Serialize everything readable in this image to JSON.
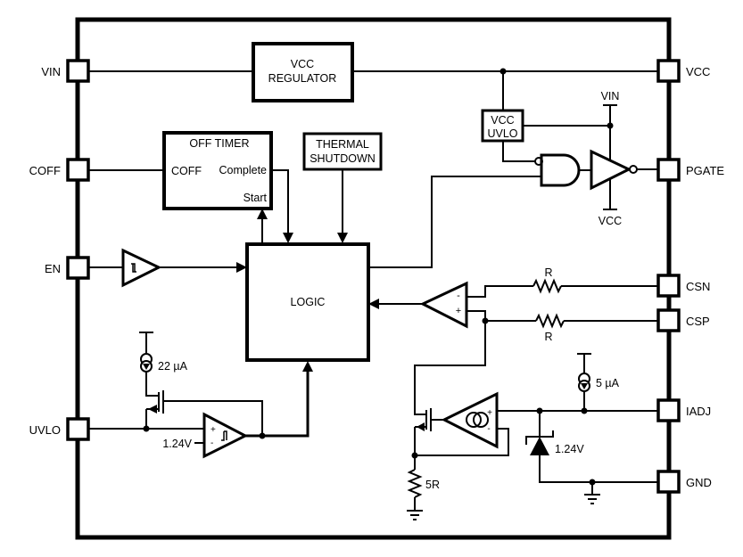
{
  "diagram": {
    "type": "block-diagram",
    "pins_left": [
      {
        "id": "vin",
        "label": "VIN"
      },
      {
        "id": "coff",
        "label": "COFF"
      },
      {
        "id": "en",
        "label": "EN"
      },
      {
        "id": "uvlo",
        "label": "UVLO"
      }
    ],
    "pins_right": [
      {
        "id": "vcc",
        "label": "VCC"
      },
      {
        "id": "pgate",
        "label": "PGATE"
      },
      {
        "id": "csn",
        "label": "CSN"
      },
      {
        "id": "csp",
        "label": "CSP"
      },
      {
        "id": "iadj",
        "label": "IADJ"
      },
      {
        "id": "gnd",
        "label": "GND"
      }
    ],
    "blocks": {
      "vcc_regulator": {
        "line1": "VCC",
        "line2": "REGULATOR"
      },
      "off_timer": {
        "title": "OFF TIMER",
        "coff": "COFF",
        "complete": "Complete",
        "start": "Start"
      },
      "thermal_shutdown": {
        "line1": "THERMAL",
        "line2": "SHUTDOWN"
      },
      "logic": {
        "label": "LOGIC"
      },
      "vcc_uvlo": {
        "line1": "VCC",
        "line2": "UVLO"
      }
    },
    "labels": {
      "driver_supply_top": "VIN",
      "driver_supply_bottom": "VCC",
      "current_source_uvlo": "22 µA",
      "uvlo_ref": "1.24V",
      "current_source_iadj": "5 µA",
      "zener_ref": "1.24V",
      "resistor_csn": "R",
      "resistor_csp": "R",
      "resistor_sense": "5R",
      "comp_minus": "-",
      "comp_plus": "+"
    }
  }
}
